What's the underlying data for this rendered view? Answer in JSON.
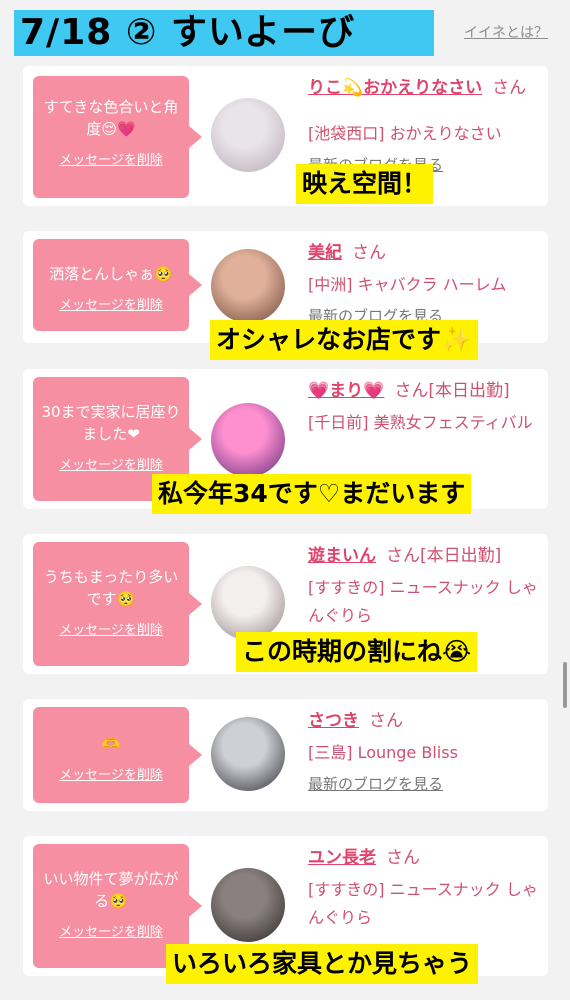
{
  "header": {
    "title": "7/18 ② すいよーび",
    "help_link": "イイネとは？"
  },
  "cards": [
    {
      "message": "すてきな色合いと角度😌💗",
      "delete_label": "メッセージを削除",
      "name": "りこ💫おかえりなさい",
      "honorific": "さん",
      "status": "",
      "shop": "[池袋西口] おかえりなさい",
      "blog_link": "最新のブログを見る",
      "caption": "映え空間！",
      "avatar_colors": [
        "#e9e4e8",
        "#b7aab3"
      ]
    },
    {
      "message": "洒落とんしゃぁ🥺",
      "delete_label": "メッセージを削除",
      "name": "美紀",
      "honorific": "さん",
      "status": "",
      "shop": "[中洲] キャバクラ ハーレム",
      "blog_link": "最新のブログを見る",
      "caption": "オシャレなお店です✨",
      "avatar_colors": [
        "#e0b09a",
        "#6b4637"
      ]
    },
    {
      "message": "30まで実家に居座りました❤",
      "delete_label": "メッセージを削除",
      "name": "💗まり💗",
      "honorific": "さん",
      "status": "[本日出勤]",
      "shop": "[千日前] 美熟女フェスティバル",
      "blog_link": "",
      "caption": "私今年34です♡まだいます",
      "avatar_colors": [
        "#ff8fcf",
        "#5a2a7a"
      ]
    },
    {
      "message": "うちもまったり多いです🥺",
      "delete_label": "メッセージを削除",
      "name": "遊まいん",
      "honorific": "さん",
      "status": "[本日出勤]",
      "shop": "[すすきの] ニュースナック しゃんぐりら",
      "blog_link": "",
      "caption": "この時期の割にね😭",
      "avatar_colors": [
        "#f4efef",
        "#8c7f82"
      ]
    },
    {
      "message": "🫶",
      "delete_label": "メッセージを削除",
      "name": "さつき",
      "honorific": "さん",
      "status": "",
      "shop": "[三島] Lounge Bliss",
      "blog_link": "最新のブログを見る",
      "caption": "",
      "avatar_colors": [
        "#cfcfd6",
        "#2a2a30"
      ]
    },
    {
      "message": "いい物件て夢が広がる🥺",
      "delete_label": "メッセージを削除",
      "name": "ユン長老",
      "honorific": "さん",
      "status": "",
      "shop": "[すすきの] ニュースナック しゃんぐりら",
      "blog_link": "",
      "caption": "いろいろ家具とか見ちゃう",
      "avatar_colors": [
        "#8a8080",
        "#2b2424"
      ]
    }
  ]
}
